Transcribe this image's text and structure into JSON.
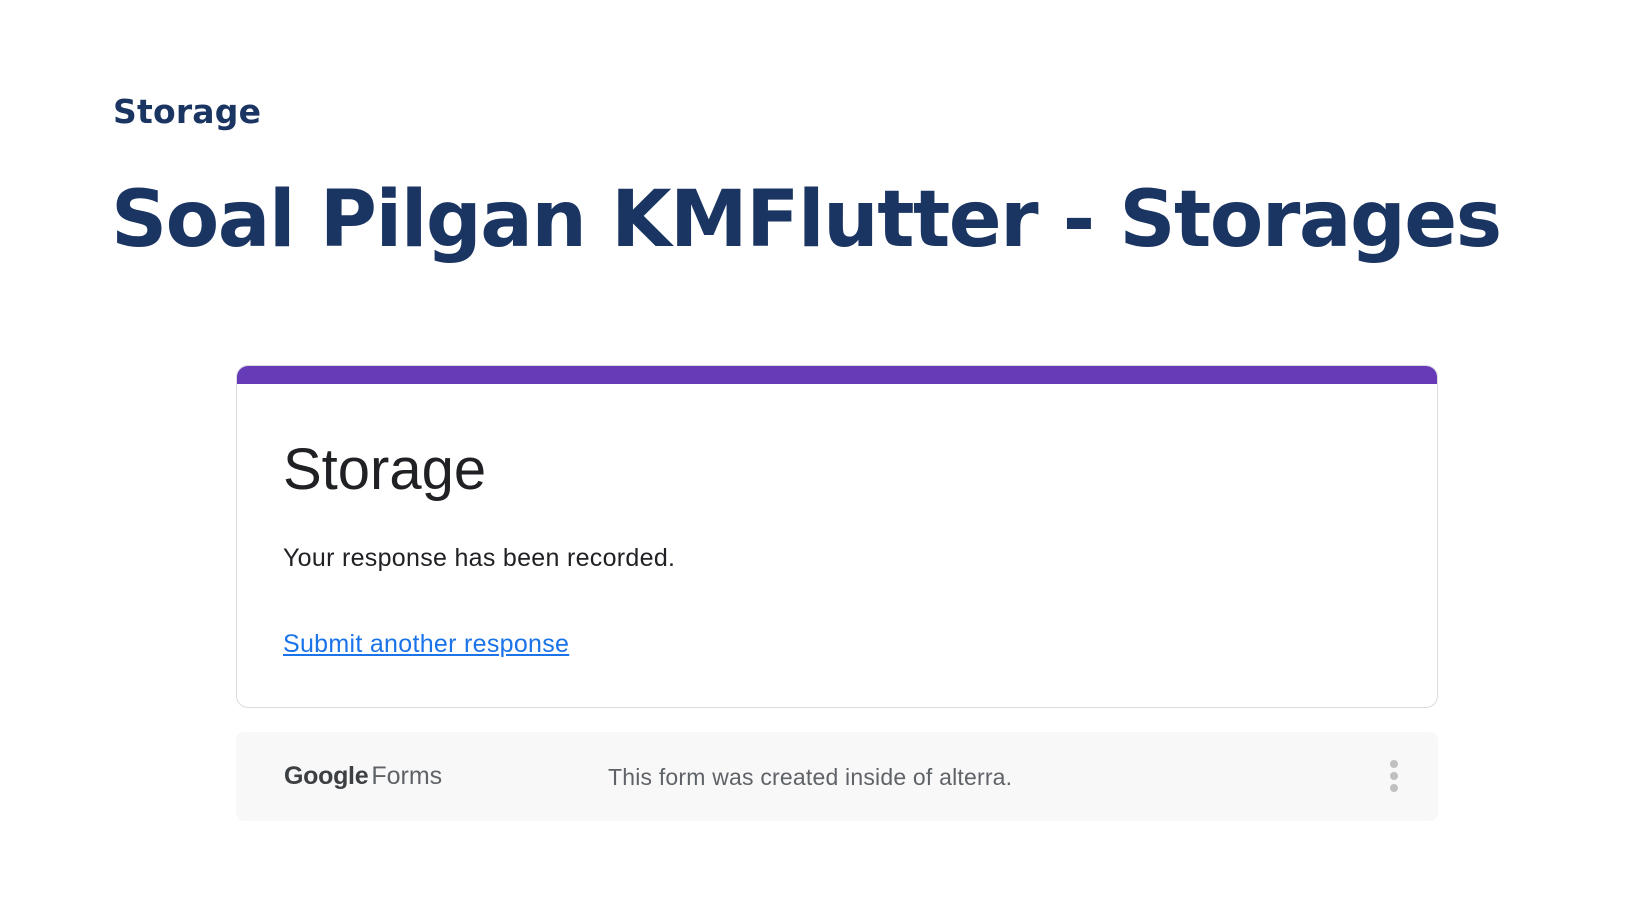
{
  "header": {
    "category": "Storage",
    "title": "Soal Pilgan KMFlutter - Storages"
  },
  "form": {
    "title": "Storage",
    "confirmation": "Your response has been recorded.",
    "submit_another_label": "Submit another response",
    "accent_color": "#673ab7",
    "link_color": "#1a73e8"
  },
  "footer": {
    "logo_google": "Google",
    "logo_forms": "Forms",
    "note": "This form was created inside of alterra.",
    "menu_icon": "more-vert-icon"
  },
  "colors": {
    "heading": "#1b3563",
    "footer_bg": "#f8f8f8"
  }
}
